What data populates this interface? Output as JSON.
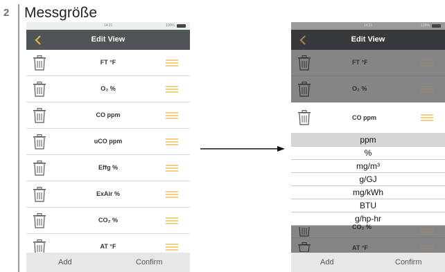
{
  "step": {
    "number": "2",
    "title": "Messgröße"
  },
  "status": {
    "time": "14:21",
    "battery": "100%"
  },
  "nav": {
    "title": "Edit View"
  },
  "left_rows": [
    {
      "label": "FT °F"
    },
    {
      "label": "O₂ %"
    },
    {
      "label": "CO ppm"
    },
    {
      "label": "uCO ppm"
    },
    {
      "label": "Effg %"
    },
    {
      "label": "ExAir %"
    },
    {
      "label": "CO₂ %"
    },
    {
      "label": "AT °F"
    }
  ],
  "right_rows": [
    {
      "label": "FT °F"
    },
    {
      "label": "O₂ %"
    },
    {
      "label": "CO ppm"
    },
    {
      "label": "CO₂ %"
    },
    {
      "label": "AT °F"
    }
  ],
  "dropdown": {
    "selected": "ppm",
    "options": [
      "ppm",
      "%",
      "mg/m³",
      "g/GJ",
      "mg/kWh",
      "BTU",
      "g/hp-hr"
    ]
  },
  "footer": {
    "add": "Add",
    "confirm": "Confirm"
  },
  "colors": {
    "navbar": "#4f5457",
    "handle": "#f0cf80",
    "overlay": "#858585"
  }
}
